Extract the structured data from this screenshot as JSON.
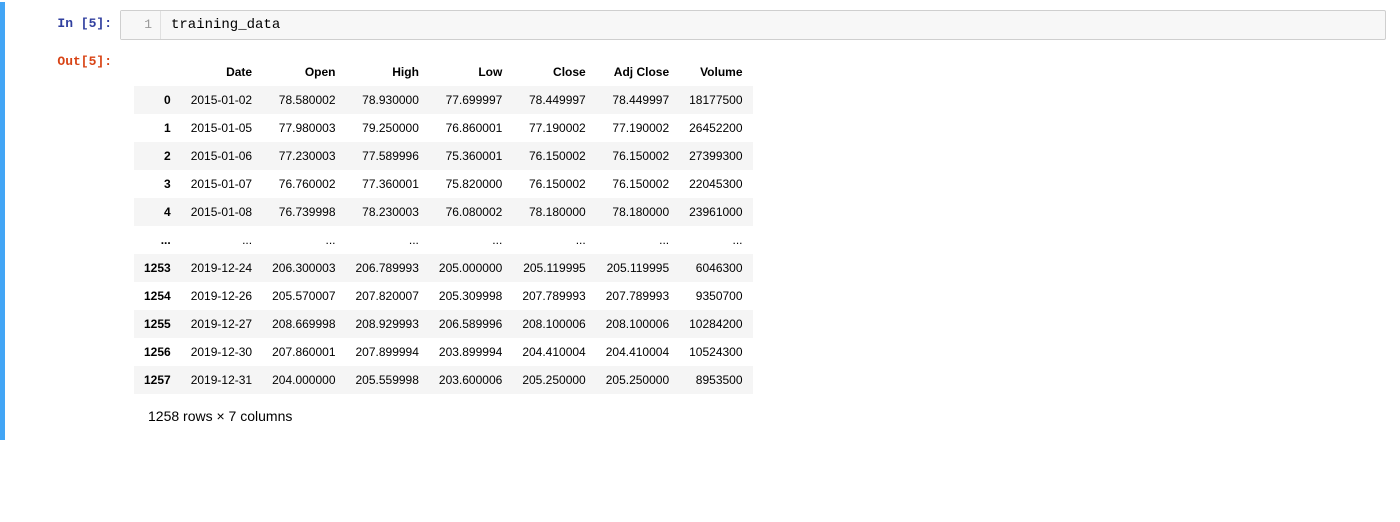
{
  "cell": {
    "in_label": "In [5]:",
    "out_label": "Out[5]:",
    "line_num": "1",
    "code": "training_data"
  },
  "dataframe": {
    "columns": [
      "Date",
      "Open",
      "High",
      "Low",
      "Close",
      "Adj Close",
      "Volume"
    ],
    "rows": [
      {
        "idx": "0",
        "Date": "2015-01-02",
        "Open": "78.580002",
        "High": "78.930000",
        "Low": "77.699997",
        "Close": "78.449997",
        "Adj": "78.449997",
        "Vol": "18177500"
      },
      {
        "idx": "1",
        "Date": "2015-01-05",
        "Open": "77.980003",
        "High": "79.250000",
        "Low": "76.860001",
        "Close": "77.190002",
        "Adj": "77.190002",
        "Vol": "26452200"
      },
      {
        "idx": "2",
        "Date": "2015-01-06",
        "Open": "77.230003",
        "High": "77.589996",
        "Low": "75.360001",
        "Close": "76.150002",
        "Adj": "76.150002",
        "Vol": "27399300"
      },
      {
        "idx": "3",
        "Date": "2015-01-07",
        "Open": "76.760002",
        "High": "77.360001",
        "Low": "75.820000",
        "Close": "76.150002",
        "Adj": "76.150002",
        "Vol": "22045300"
      },
      {
        "idx": "4",
        "Date": "2015-01-08",
        "Open": "76.739998",
        "High": "78.230003",
        "Low": "76.080002",
        "Close": "78.180000",
        "Adj": "78.180000",
        "Vol": "23961000"
      },
      {
        "idx": "...",
        "Date": "...",
        "Open": "...",
        "High": "...",
        "Low": "...",
        "Close": "...",
        "Adj": "...",
        "Vol": "..."
      },
      {
        "idx": "1253",
        "Date": "2019-12-24",
        "Open": "206.300003",
        "High": "206.789993",
        "Low": "205.000000",
        "Close": "205.119995",
        "Adj": "205.119995",
        "Vol": "6046300"
      },
      {
        "idx": "1254",
        "Date": "2019-12-26",
        "Open": "205.570007",
        "High": "207.820007",
        "Low": "205.309998",
        "Close": "207.789993",
        "Adj": "207.789993",
        "Vol": "9350700"
      },
      {
        "idx": "1255",
        "Date": "2019-12-27",
        "Open": "208.669998",
        "High": "208.929993",
        "Low": "206.589996",
        "Close": "208.100006",
        "Adj": "208.100006",
        "Vol": "10284200"
      },
      {
        "idx": "1256",
        "Date": "2019-12-30",
        "Open": "207.860001",
        "High": "207.899994",
        "Low": "203.899994",
        "Close": "204.410004",
        "Adj": "204.410004",
        "Vol": "10524300"
      },
      {
        "idx": "1257",
        "Date": "2019-12-31",
        "Open": "204.000000",
        "High": "205.559998",
        "Low": "203.600006",
        "Close": "205.250000",
        "Adj": "205.250000",
        "Vol": "8953500"
      }
    ],
    "footer": "1258 rows × 7 columns"
  }
}
